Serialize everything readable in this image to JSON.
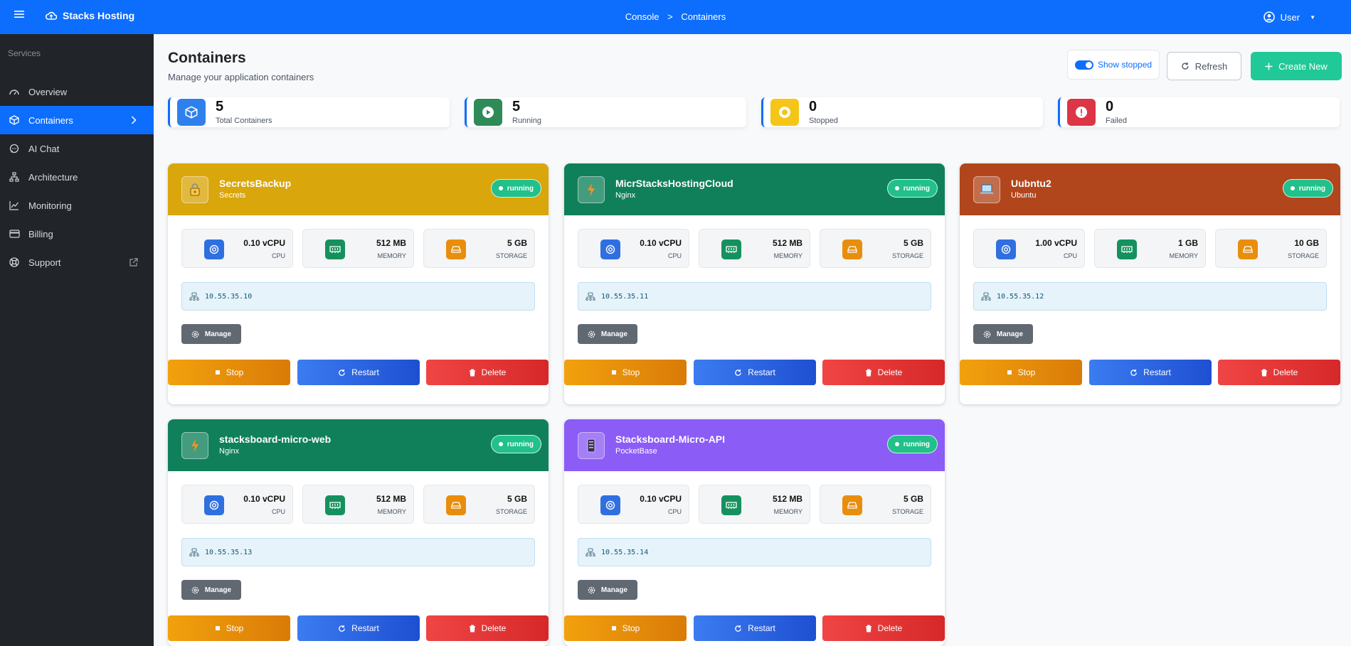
{
  "navbar": {
    "menu_icon": "hamburger-icon",
    "brand": "Stacks Hosting",
    "brand_icon": "cloud-icon",
    "breadcrumb": [
      "Console",
      "Containers"
    ],
    "breadcrumb_separator": ">",
    "user_label": "User",
    "user_icon": "user-circle-icon",
    "color": "#0d6efd"
  },
  "sidebar": {
    "heading": "Services",
    "items": [
      {
        "label": "Overview",
        "icon": "dashboard-icon"
      },
      {
        "label": "Containers",
        "icon": "box-icon",
        "active": true
      },
      {
        "label": "AI Chat",
        "icon": "chat-icon"
      },
      {
        "label": "Architecture",
        "icon": "diagram-icon"
      },
      {
        "label": "Monitoring",
        "icon": "chart-icon"
      },
      {
        "label": "Billing",
        "icon": "card-icon"
      },
      {
        "label": "Support",
        "icon": "lifebuoy-icon",
        "external": true
      }
    ]
  },
  "header": {
    "title": "Containers",
    "subtitle": "Manage your application containers",
    "show_stopped_label": "Show stopped",
    "show_stopped_on": true,
    "refresh_label": "Refresh",
    "create_label": "Create New"
  },
  "stats": [
    {
      "value": "5",
      "label": "Total Containers",
      "icon": "box-icon",
      "color": "#2f80ed"
    },
    {
      "value": "5",
      "label": "Running",
      "icon": "play-icon",
      "color": "#2e8b57"
    },
    {
      "value": "0",
      "label": "Stopped",
      "icon": "stop-circle-icon",
      "color": "#f5c518"
    },
    {
      "value": "0",
      "label": "Failed",
      "icon": "alert-icon",
      "color": "#dc3545"
    }
  ],
  "containers": [
    {
      "name": "SecretsBackup",
      "type": "Secrets",
      "status": "running",
      "color": "#d9a60c",
      "icon": "lock-icon",
      "cpu": "0.10 vCPU",
      "memory": "512 MB",
      "storage": "5 GB",
      "ip": "10.55.35.10"
    },
    {
      "name": "MicrStacksHostingCloud",
      "type": "Nginx",
      "status": "running",
      "color": "#10805a",
      "icon": "bolt-icon",
      "cpu": "0.10 vCPU",
      "memory": "512 MB",
      "storage": "5 GB",
      "ip": "10.55.35.11"
    },
    {
      "name": "Uubntu2",
      "type": "Ubuntu",
      "status": "running",
      "color": "#b1461c",
      "icon": "laptop-icon",
      "cpu": "1.00 vCPU",
      "memory": "1 GB",
      "storage": "10 GB",
      "ip": "10.55.35.12"
    },
    {
      "name": "stacksboard-micro-web",
      "type": "Nginx",
      "status": "running",
      "color": "#10805a",
      "icon": "bolt-icon",
      "cpu": "0.10 vCPU",
      "memory": "512 MB",
      "storage": "5 GB",
      "ip": "10.55.35.13"
    },
    {
      "name": "Stacksboard-Micro-API",
      "type": "PocketBase",
      "status": "running",
      "color": "#8b5cf6",
      "icon": "database-icon",
      "cpu": "0.10 vCPU",
      "memory": "512 MB",
      "storage": "5 GB",
      "ip": "10.55.35.14"
    }
  ],
  "labels": {
    "cpu": "CPU",
    "memory": "MEMORY",
    "storage": "STORAGE",
    "manage": "Manage",
    "stop": "Stop",
    "restart": "Restart",
    "delete": "Delete"
  }
}
